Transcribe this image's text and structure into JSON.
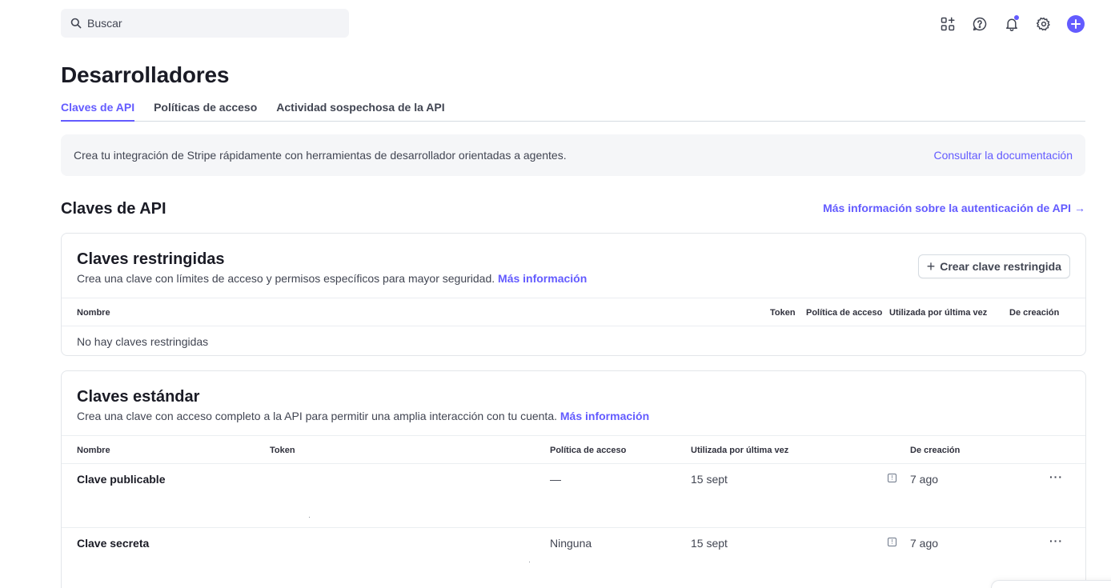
{
  "search": {
    "placeholder": "Buscar"
  },
  "toolbar_icons": [
    "apps-add-icon",
    "help-icon",
    "bell-icon",
    "gear-icon",
    "plus-icon"
  ],
  "page_title": "Desarrolladores",
  "tabs": [
    {
      "label": "Claves de API",
      "active": true
    },
    {
      "label": "Políticas de acceso",
      "active": false
    },
    {
      "label": "Actividad sospechosa de la API",
      "active": false
    }
  ],
  "banner": {
    "text": "Crea tu integración de Stripe rápidamente con herramientas de desarrollador orientadas a agentes.",
    "link": "Consultar la documentación"
  },
  "section": {
    "title": "Claves de API",
    "link": "Más información sobre la autenticación de API",
    "link_arrow": "→"
  },
  "restricted": {
    "title": "Claves restringidas",
    "description": "Crea una clave con límites de acceso y permisos específicos para mayor seguridad.",
    "more_link": "Más información",
    "button_label": "Crear clave restringida",
    "columns": [
      "Nombre",
      "Token",
      "Política de acceso",
      "Utilizada por última vez",
      "De creación"
    ],
    "empty": "No hay claves restringidas"
  },
  "standard": {
    "title": "Claves estándar",
    "description": "Crea una clave con acceso completo a la API para permitir una amplia interacción con tu cuenta.",
    "more_link": "Más información",
    "columns": [
      "Nombre",
      "Token",
      "Política de acceso",
      "Utilizada por última vez",
      "De creación"
    ],
    "rows": [
      {
        "name": "Clave publicable",
        "policy": "—",
        "last_used": "15 sept",
        "created": "7 ago"
      },
      {
        "name": "Clave secreta",
        "policy": "Ninguna",
        "last_used": "15 sept",
        "created": "7 ago"
      }
    ]
  },
  "colors": {
    "accent": "#635bff",
    "text": "#30313d",
    "muted": "#414552",
    "border": "#e3e6ea"
  }
}
